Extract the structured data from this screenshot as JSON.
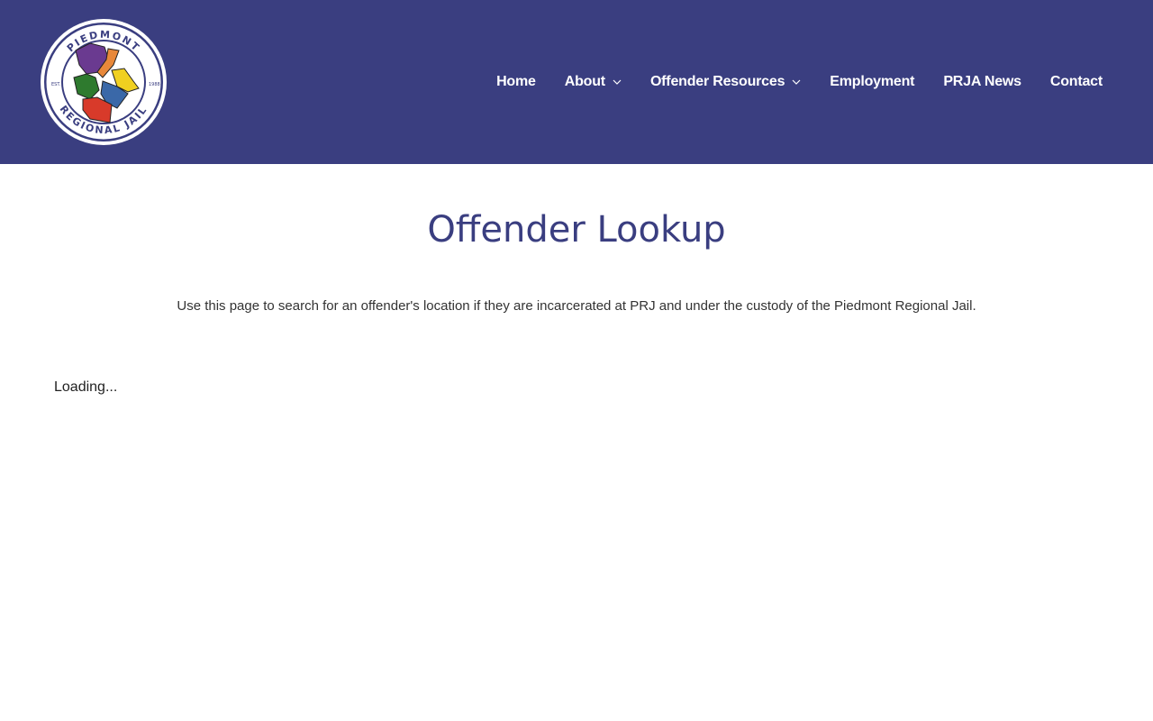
{
  "header": {
    "logo": {
      "top_text": "PIEDMONT",
      "bottom_text": "REGIONAL JAIL",
      "left_text": "EST.",
      "right_text": "1988"
    },
    "nav": [
      {
        "label": "Home",
        "has_dropdown": false
      },
      {
        "label": "About",
        "has_dropdown": true
      },
      {
        "label": "Offender Resources",
        "has_dropdown": true
      },
      {
        "label": "Employment",
        "has_dropdown": false
      },
      {
        "label": "PRJA News",
        "has_dropdown": false
      },
      {
        "label": "Contact",
        "has_dropdown": false
      }
    ]
  },
  "main": {
    "title": "Offender Lookup",
    "intro": "Use this page to search for an offender's location if they are incarcerated at PRJ and under the custody of the Piedmont Regional Jail.",
    "loading": "Loading..."
  },
  "colors": {
    "header_bg": "#3a3e80",
    "title": "#3a3e80",
    "text": "#333333"
  }
}
